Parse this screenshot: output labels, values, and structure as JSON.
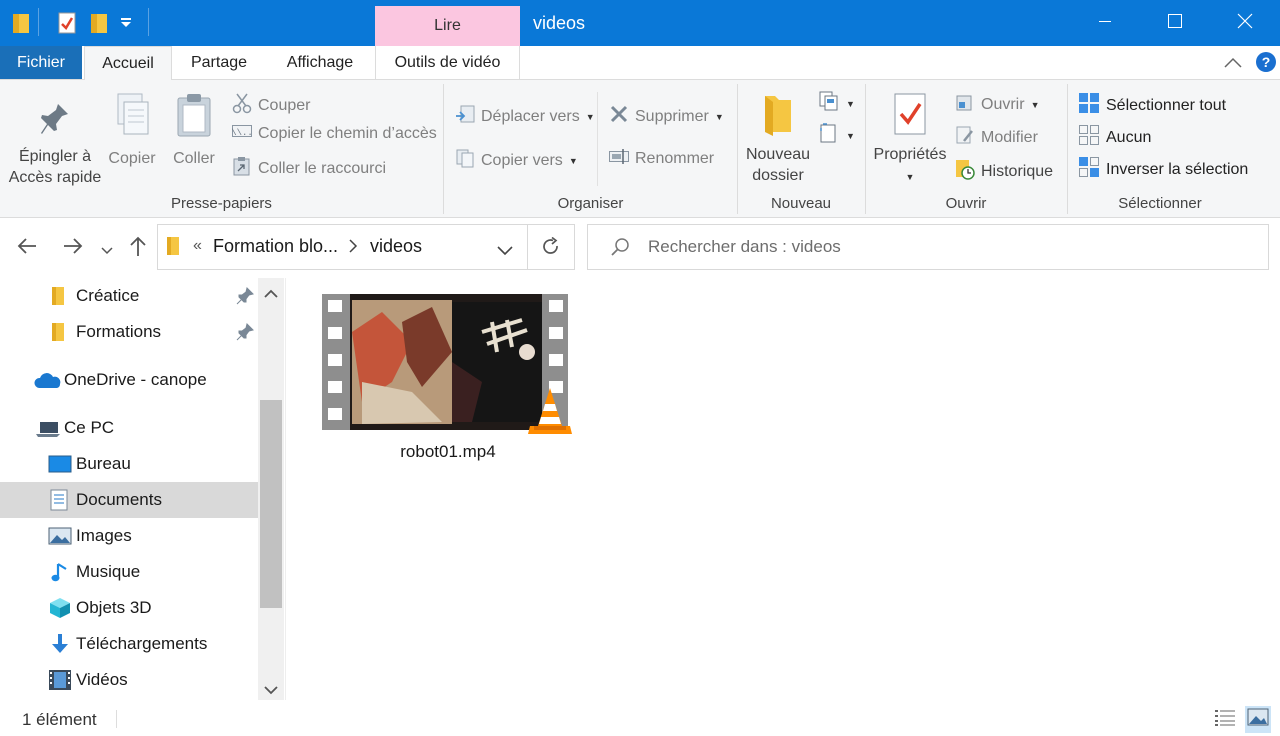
{
  "window": {
    "title": "videos",
    "contextual_tab": "Lire",
    "minimize_icon": "minimize-icon",
    "maximize_icon": "maximize-icon",
    "close_icon": "close-icon"
  },
  "tabs": {
    "file": "Fichier",
    "home": "Accueil",
    "share": "Partage",
    "view": "Affichage",
    "video_tools": "Outils de vidéo"
  },
  "ribbon": {
    "clipboard": {
      "label": "Presse-papiers",
      "pin_line1": "Épingler à",
      "pin_line2": "Accès rapide",
      "copy": "Copier",
      "paste": "Coller",
      "cut": "Couper",
      "copy_path": "Copier le chemin d’accès",
      "paste_shortcut": "Coller le raccourci"
    },
    "organize": {
      "label": "Organiser",
      "move_to": "Déplacer vers",
      "copy_to": "Copier vers",
      "delete": "Supprimer",
      "rename": "Renommer"
    },
    "new": {
      "label": "Nouveau",
      "new_folder_line1": "Nouveau",
      "new_folder_line2": "dossier"
    },
    "open": {
      "label": "Ouvrir",
      "properties": "Propriétés",
      "open": "Ouvrir",
      "edit": "Modifier",
      "history": "Historique"
    },
    "select": {
      "label": "Sélectionner",
      "select_all": "Sélectionner tout",
      "none": "Aucun",
      "invert": "Inverser la sélection"
    }
  },
  "address": {
    "prefix": "«",
    "crumb1": "Formation blo...",
    "crumb2": "videos",
    "search_placeholder": "Rechercher dans : videos"
  },
  "nav": {
    "items": [
      {
        "label": "Créatice",
        "icon": "folder-icon",
        "pinned": true
      },
      {
        "label": "Formations",
        "icon": "folder-icon",
        "pinned": true
      },
      {
        "label": "OneDrive - canope",
        "icon": "onedrive-cloud-icon"
      },
      {
        "label": "Ce PC",
        "icon": "laptop-icon"
      },
      {
        "label": "Bureau",
        "icon": "desktop-icon"
      },
      {
        "label": "Documents",
        "icon": "documents-icon",
        "selected": true
      },
      {
        "label": "Images",
        "icon": "pictures-icon"
      },
      {
        "label": "Musique",
        "icon": "music-note-icon"
      },
      {
        "label": "Objets 3D",
        "icon": "cube-icon"
      },
      {
        "label": "Téléchargements",
        "icon": "download-arrow-icon"
      },
      {
        "label": "Vidéos",
        "icon": "video-film-icon"
      }
    ]
  },
  "content": {
    "file_name": "robot01.mp4"
  },
  "status": {
    "count": "1 élément"
  },
  "colors": {
    "titlebar": "#0a78d7",
    "file_tab": "#1a6fb8",
    "contextual_tab": "#fbc6e0",
    "ribbon_bg": "#f5f6f7",
    "selection": "#d9d9d9"
  }
}
